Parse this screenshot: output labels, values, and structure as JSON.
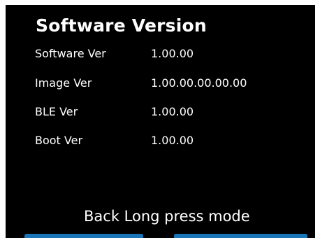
{
  "screen": {
    "title": "Software Version",
    "rows": [
      {
        "label": "Software Ver",
        "value": "1.00.00"
      },
      {
        "label": "Image Ver",
        "value": "1.00.00.00.00.00"
      },
      {
        "label": "BLE Ver",
        "value": "1.00.00"
      },
      {
        "label": "Boot Ver",
        "value": "1.00.00"
      }
    ],
    "mode_text": "Back Long press mode"
  },
  "colors": {
    "background": "#000000",
    "text": "#ffffff",
    "softkey": "#1a75b8"
  }
}
